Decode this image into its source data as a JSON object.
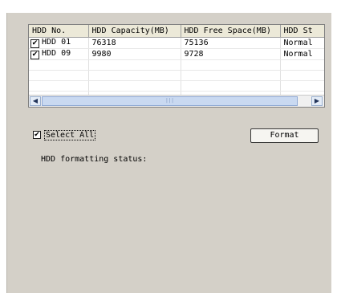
{
  "table": {
    "columns": [
      "HDD No.",
      "HDD Capacity(MB)",
      "HDD Free Space(MB)",
      "HDD St"
    ],
    "rows": [
      {
        "checked": true,
        "no": "HDD 01",
        "capacity": "76318",
        "free": "75136",
        "status": "Normal"
      },
      {
        "checked": true,
        "no": "HDD 09",
        "capacity": "9980",
        "free": "9728",
        "status": "Normal"
      }
    ]
  },
  "select_all": {
    "label": "Select All",
    "checked": true
  },
  "format_button": "Format",
  "status_label": "HDD formatting status:",
  "icons": {
    "scroll_left": "chevron-left-icon",
    "scroll_right": "chevron-right-icon",
    "check": "check-icon"
  }
}
